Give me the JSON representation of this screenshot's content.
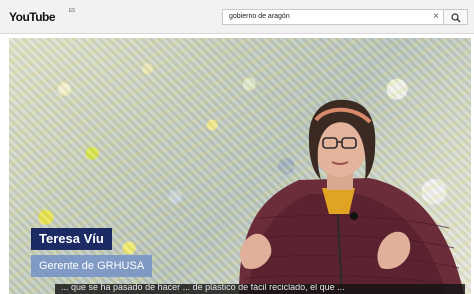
{
  "header": {
    "logo_text": "YouTube",
    "region_code": "ES"
  },
  "search": {
    "query": "gobierno de aragón"
  },
  "icons": {
    "clear": "close-icon",
    "search": "search-icon"
  },
  "video": {
    "lower_third": {
      "name": "Teresa Víu",
      "role": "Gerente de GRHUSA",
      "name_bg": "#1c2b63",
      "role_bg": "#7a96c4"
    },
    "subtitle": "... que se ha pasado de hacer ... de plástico de fácil reciclado, el que ..."
  }
}
